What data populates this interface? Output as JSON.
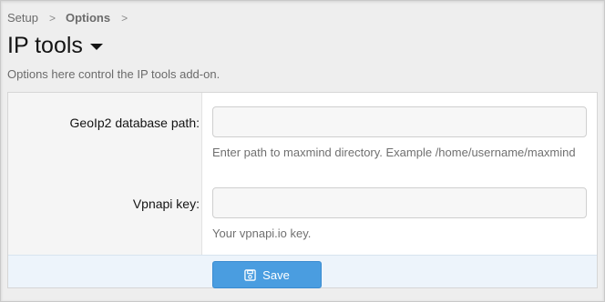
{
  "breadcrumb": {
    "items": [
      {
        "label": "Setup"
      },
      {
        "label": "Options"
      }
    ],
    "separator": ">"
  },
  "page": {
    "title": "IP tools",
    "description": "Options here control the IP tools add-on."
  },
  "form": {
    "fields": [
      {
        "label": "GeoIp2 database path:",
        "value": "",
        "hint": "Enter path to maxmind directory. Example /home/username/maxmind"
      },
      {
        "label": "Vpnapi key:",
        "value": "",
        "hint": "Your vpnapi.io key."
      }
    ],
    "save_label": "Save",
    "save_icon": "floppy-disk-icon"
  },
  "colors": {
    "accent": "#4a9de0",
    "footer_bg": "#edf4fb",
    "page_bg": "#eeeeee"
  }
}
